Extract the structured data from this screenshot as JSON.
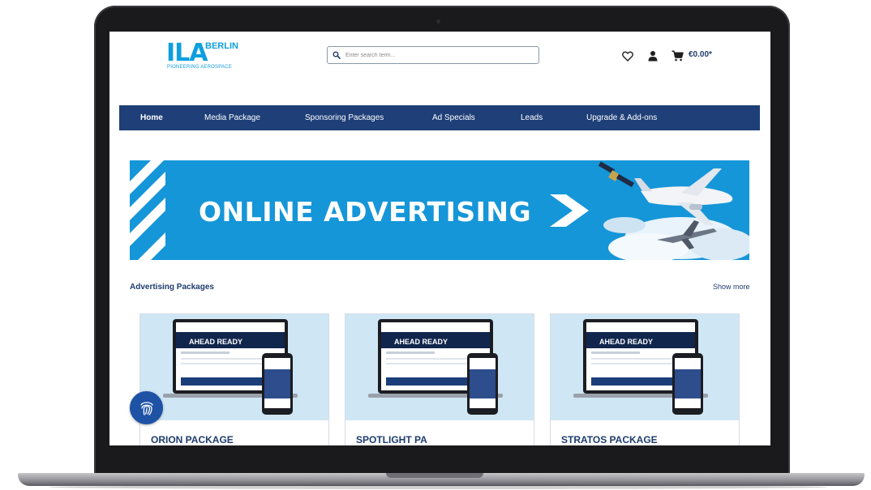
{
  "logo": {
    "mark": "ILA",
    "city": "BERLIN",
    "tagline": "PIONEERING AEROSPACE"
  },
  "search": {
    "placeholder": "Enter search term..."
  },
  "header": {
    "cart_total": "€0.00*"
  },
  "nav": {
    "items": [
      {
        "label": "Home",
        "active": true
      },
      {
        "label": "Media Package"
      },
      {
        "label": "Sponsoring Packages"
      },
      {
        "label": "Ad Specials"
      },
      {
        "label": "Leads"
      },
      {
        "label": "Upgrade & Add-ons"
      }
    ]
  },
  "banner": {
    "title": "ONLINE ADVERTISING"
  },
  "section": {
    "title": "Advertising Packages",
    "show_more": "Show more"
  },
  "cards": [
    {
      "title": "ORION PACKAGE"
    },
    {
      "title": "SPOTLIGHT PA"
    },
    {
      "title": "STRATOS PACKAGE"
    }
  ],
  "mockup": {
    "headline": "AHEAD READY"
  },
  "colors": {
    "brand_blue": "#1e3f78",
    "accent_blue": "#1596d8",
    "logo_blue": "#0e9fde",
    "card_bg": "#cfe7f5"
  },
  "icons": {
    "search": "magnifier-icon",
    "wishlist": "heart-icon",
    "account": "user-icon",
    "cart": "cart-icon",
    "privacy": "fingerprint-icon"
  }
}
